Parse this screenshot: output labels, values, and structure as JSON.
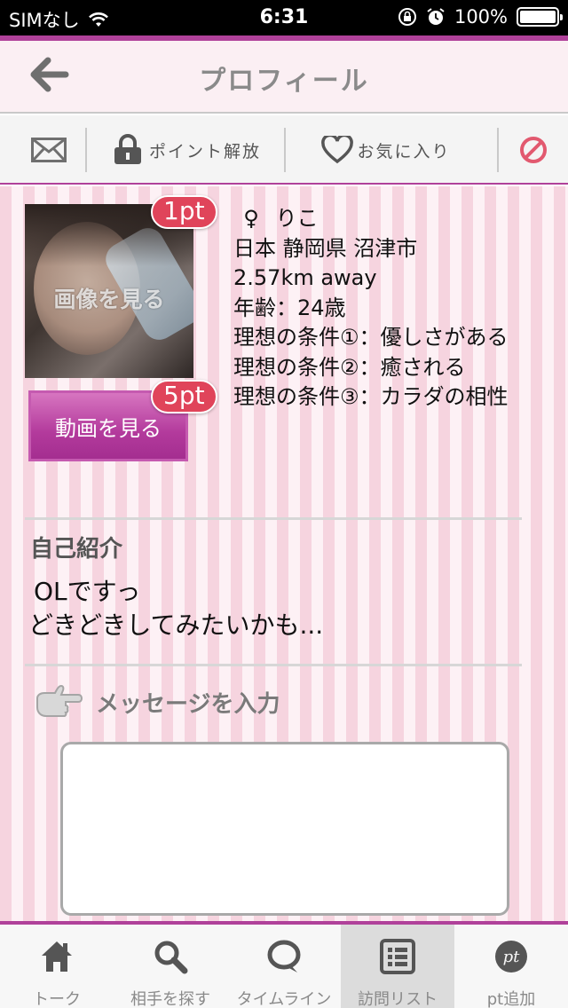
{
  "status_bar": {
    "carrier": "SIMなし",
    "time": "6:31",
    "battery": "100%",
    "battery_level": 1.0
  },
  "header": {
    "title": "プロフィール"
  },
  "actions": {
    "point_unlock": "ポイント解放",
    "favorite": "お気に入り"
  },
  "profile": {
    "photo_label": "画像を見る",
    "photo_cost": "1pt",
    "video_label": "動画を見る",
    "video_cost": "5pt",
    "gender_symbol": "♀",
    "name": "りこ",
    "location": "日本 静岡県 沼津市",
    "distance": "2.57km away",
    "age": "年齢：24歳",
    "condition1": "理想の条件①：優しさがある",
    "condition2": "理想の条件②：癒される",
    "condition3": "理想の条件③：カラダの相性"
  },
  "intro": {
    "title": "自己紹介",
    "line1": "OLですっ",
    "line2": "どきどきしてみたいかも..."
  },
  "message": {
    "label": "メッセージを入力",
    "value": ""
  },
  "tabs": [
    {
      "label": "トーク",
      "icon": "house-icon"
    },
    {
      "label": "相手を探す",
      "icon": "search-icon"
    },
    {
      "label": "タイムライン",
      "icon": "speech-bubble-icon"
    },
    {
      "label": "訪問リスト",
      "icon": "list-icon"
    },
    {
      "label": "pt追加",
      "icon": "pt-coin-icon"
    }
  ],
  "colors": {
    "accent": "#b0419a",
    "badge": "#e0445a",
    "stripe_dark": "#f6d4df",
    "stripe_light": "#fdf1f5"
  }
}
